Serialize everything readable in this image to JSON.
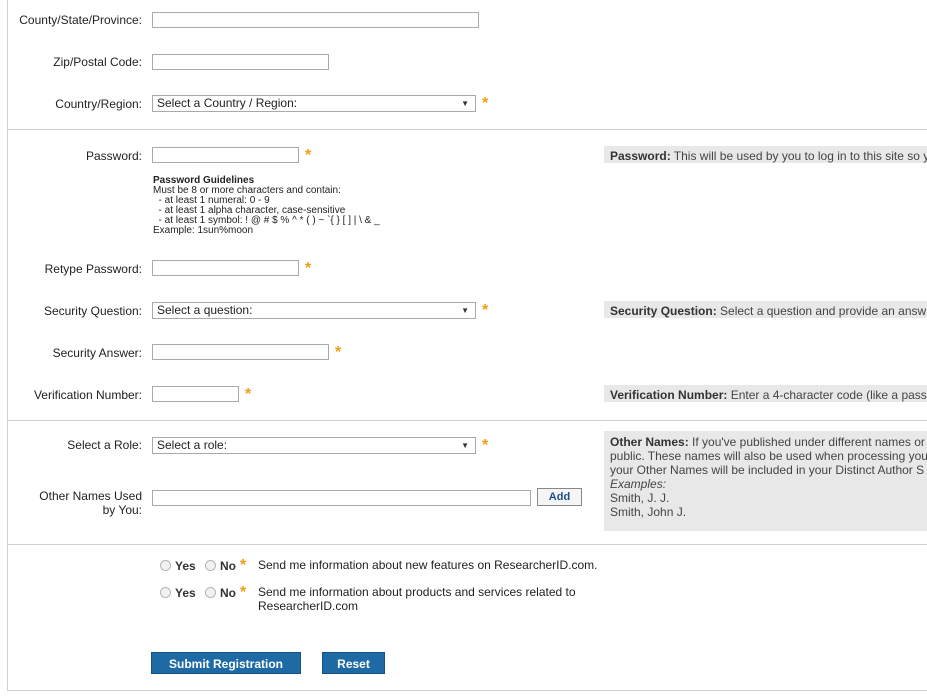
{
  "address": {
    "county_label": "County/State/Province:",
    "zip_label": "Zip/Postal Code:",
    "country_label": "Country/Region:",
    "country_select": "Select a Country / Region:"
  },
  "password": {
    "label": "Password:",
    "guidelines_title": "Password Guidelines",
    "guidelines": [
      "Must be 8 or more characters and contain:",
      "  - at least 1 numeral: 0 - 9",
      "  - at least 1 alpha character, case-sensitive",
      "  - at least 1 symbol: ! @ # $ % ^ * ( ) ~ `{ } [ ] | \\ & _",
      "Example: 1sun%moon"
    ],
    "help_title": "Password:",
    "help_text": " This will be used by you to log in to this site so y",
    "retype_label": "Retype Password:"
  },
  "security": {
    "question_label": "Security Question:",
    "question_select": "Select a question:",
    "help_title": "Security Question:",
    "help_text": " Select a question and provide an answ",
    "answer_label": "Security Answer:"
  },
  "verification": {
    "label": "Verification Number:",
    "help_title": "Verification Number:",
    "help_text": " Enter a 4-character code (like a pass"
  },
  "role": {
    "label": "Select a Role:",
    "select": "Select a role:"
  },
  "other_names": {
    "label_line1": "Other Names Used",
    "label_line2": "by You:",
    "add_label": "Add",
    "help_title": "Other Names:",
    "help_line1": " If you've published under different names or",
    "help_line2": "public. These names will also be used when processing you",
    "help_line3": "your Other Names will be included in your Distinct Author S",
    "examples_label": "Examples:",
    "example1": "Smith, J. J.",
    "example2": "Smith, John J."
  },
  "optins": {
    "yes": "Yes",
    "no": "No",
    "msg1": "Send me information about new features on ResearcherID.com.",
    "msg2_line1": "Send me information about products and services related to",
    "msg2_line2": "ResearcherID.com"
  },
  "buttons": {
    "submit": "Submit Registration",
    "reset": "Reset"
  },
  "required_marker": "*",
  "colors": {
    "accent": "#1d6aa5",
    "required": "#f39c12"
  }
}
